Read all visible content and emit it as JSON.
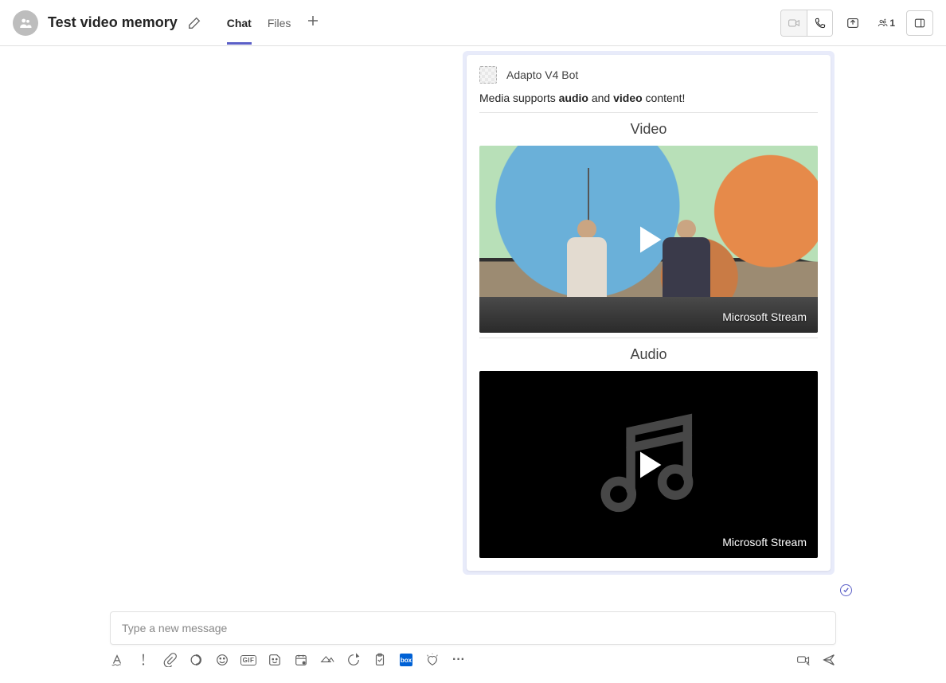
{
  "header": {
    "chat_title": "Test video memory",
    "tabs": [
      {
        "label": "Chat",
        "active": true
      },
      {
        "label": "Files",
        "active": false
      }
    ],
    "people_count": "1"
  },
  "message": {
    "bot_name": "Adapto V4 Bot",
    "intro_pre": "Media supports ",
    "intro_b1": "audio",
    "intro_mid": " and ",
    "intro_b2": "video",
    "intro_post": " content!",
    "video_title": "Video",
    "audio_title": "Audio",
    "media_brand": "Microsoft Stream"
  },
  "composer": {
    "placeholder": "Type a new message",
    "gif_label": "GIF",
    "box_label": "box",
    "dots": "···"
  }
}
